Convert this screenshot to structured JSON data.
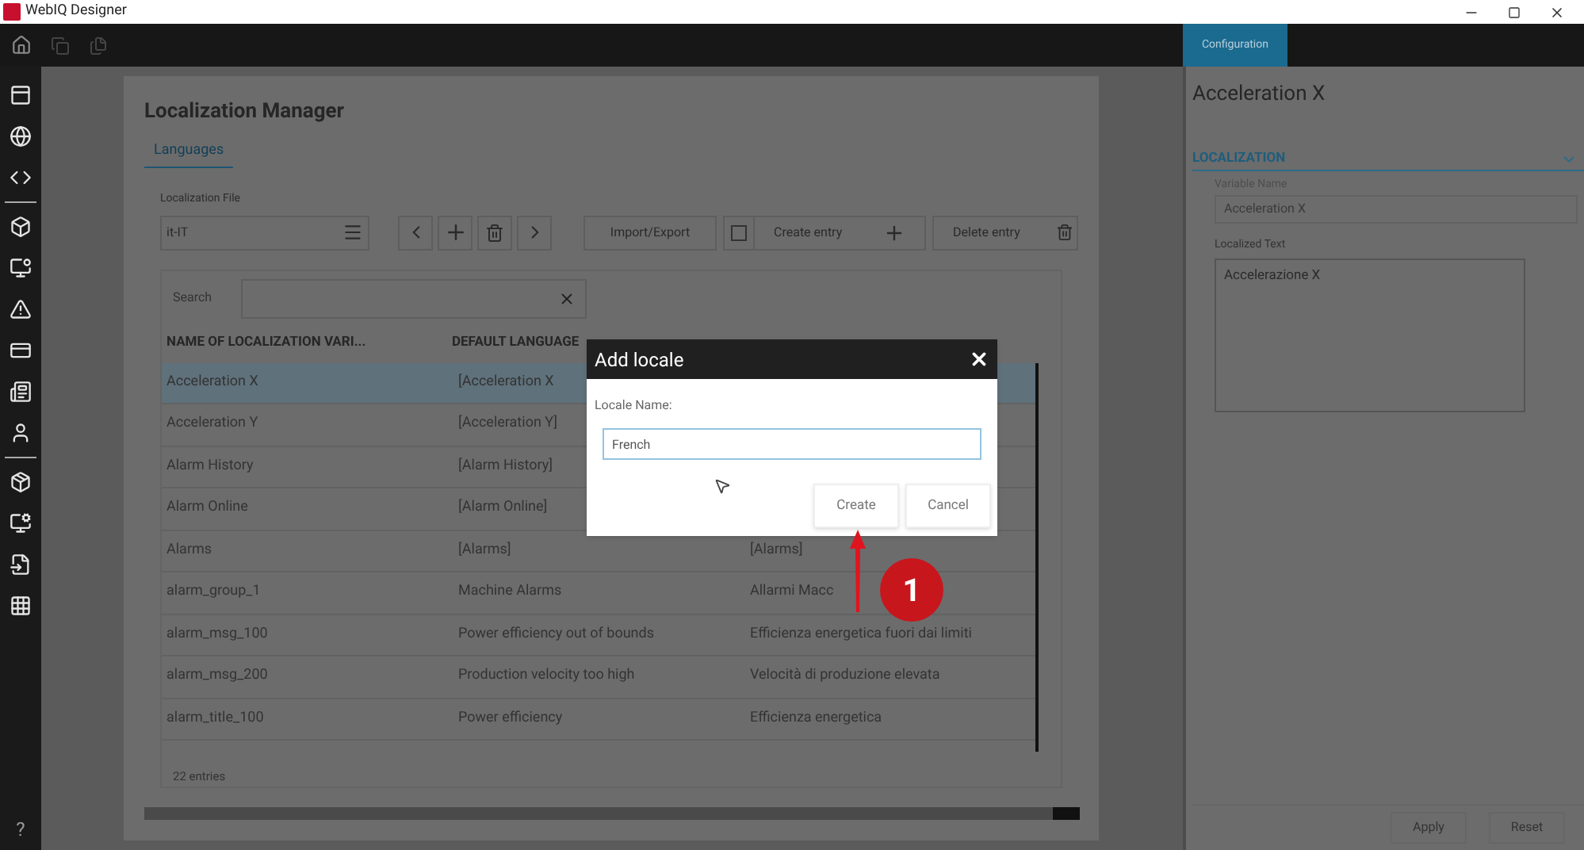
{
  "window": {
    "title": "WebIQ Designer"
  },
  "config_tab": {
    "label": "Configuration",
    "selected": true
  },
  "manager": {
    "title": "Localization Manager",
    "tabs": [
      {
        "label": "Languages",
        "selected": true
      }
    ],
    "file_label": "Localization File",
    "file_value": "it-IT",
    "import_export": "Import/Export",
    "create_entry": "Create entry",
    "create_checked": false,
    "delete_entry": "Delete entry",
    "search_label": "Search",
    "columns": [
      "NAME OF LOCALIZATION VARI...",
      "DEFAULT LANGUAGE"
    ],
    "rows": [
      {
        "name": "Acceleration X",
        "default": "[Acceleration X",
        "localized": "",
        "selected": true
      },
      {
        "name": "Acceleration Y",
        "default": "[Acceleration Y]",
        "localized": "",
        "selected": false
      },
      {
        "name": "Alarm History",
        "default": "[Alarm History]",
        "localized": "",
        "selected": false
      },
      {
        "name": "Alarm Online",
        "default": "[Alarm Online]",
        "localized": "",
        "selected": false
      },
      {
        "name": "Alarms",
        "default": "[Alarms]",
        "localized": "[Alarms]",
        "selected": false
      },
      {
        "name": "alarm_group_1",
        "default": "Machine Alarms",
        "localized": "Allarmi Macc",
        "selected": false
      },
      {
        "name": "alarm_msg_100",
        "default": "Power efficiency out of bounds",
        "localized": "Efficienza energetica fuori dai limiti",
        "selected": false
      },
      {
        "name": "alarm_msg_200",
        "default": "Production velocity too high",
        "localized": "Velocità di produzione elevata",
        "selected": false
      },
      {
        "name": "alarm_title_100",
        "default": "Power efficiency",
        "localized": "Efficienza energetica",
        "selected": false
      }
    ],
    "entries": "22 entries"
  },
  "dialog": {
    "title": "Add locale",
    "field_label": "Locale Name:",
    "value": "French",
    "buttons": [
      "Create",
      "Cancel"
    ]
  },
  "step_badge": "1",
  "config": {
    "title": "Acceleration X",
    "section": "LOCALIZATION",
    "expanded": true,
    "variable_label": "Variable Name",
    "variable_value": "Acceleration X",
    "text_label": "Localized Text",
    "text_value": "Accelerazione X",
    "buttons": [
      "Apply",
      "Reset"
    ]
  },
  "help": "?"
}
